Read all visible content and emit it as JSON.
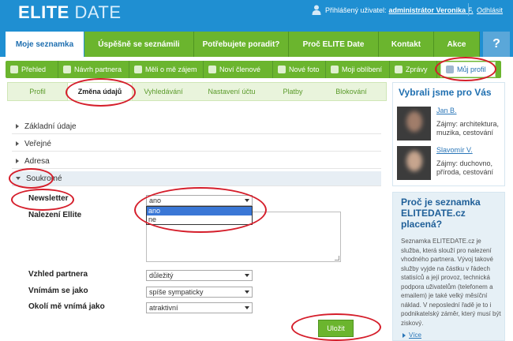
{
  "header": {
    "logo_elite": "ELITE",
    "logo_date": "DATE",
    "logged_in_label": "Přihlášený uživatel:",
    "logged_in_user": "administrátor Veronika F.",
    "logout": "Odhlásit"
  },
  "main_nav": {
    "items": [
      "Moje seznamka",
      "Úspěšně se seznámili",
      "Potřebujete poradit?",
      "Proč ELITE Date",
      "Kontakt",
      "Akce"
    ],
    "help": "?"
  },
  "sub_nav": {
    "items": [
      "Přehled",
      "Návrh partnera",
      "Měli o mě zájem",
      "Noví členové",
      "Nové foto",
      "Moji oblíbení",
      "Zprávy",
      "Můj profil"
    ]
  },
  "tabs": [
    "Profil",
    "Změna údajů",
    "Vyhledávání",
    "Nastavení účtu",
    "Platby",
    "Blokování"
  ],
  "accordion": [
    "Základní údaje",
    "Veřejné",
    "Adresa",
    "Soukromé"
  ],
  "form": {
    "newsletter_label": "Newsletter",
    "newsletter_value": "ano",
    "newsletter_options": [
      "ano",
      "ne"
    ],
    "nalezeni_label": "Nalezení Ellite",
    "vzhled_label": "Vzhled partnera",
    "vzhled_value": "důležitý",
    "vnimam_label": "Vnímám se jako",
    "vnimam_value": "spíše sympaticky",
    "okoli_label": "Okolí mě vnímá jako",
    "okoli_value": "atraktivní",
    "save": "Uložit"
  },
  "sidebar": {
    "picked_title": "Vybrali jsme pro Vás",
    "profiles": [
      {
        "name": "Jan B.",
        "interests": "Zájmy: architektura, muzika, cestování"
      },
      {
        "name": "Slavomír V.",
        "interests": "Zájmy: duchovno, příroda, cestování"
      }
    ],
    "why_title": "Proč je seznamka ELITEDATE.cz placená?",
    "why_body": "Seznamka ELITEDATE.cz je služba, která slouží pro nalezení vhodného partnera. Vývoj takové služby vyjde na částku v řádech statisíců a její provoz, technická podpora uživatelům (telefonem a emailem) je také velký měsíční náklad. V neposlední řadě je to i podnikatelský záměr, který musí být ziskový.",
    "more": "Více"
  },
  "colors": {
    "header_blue": "#1f8fd2",
    "nav_green": "#6bb52e",
    "annotation_red": "#d51e2b"
  }
}
